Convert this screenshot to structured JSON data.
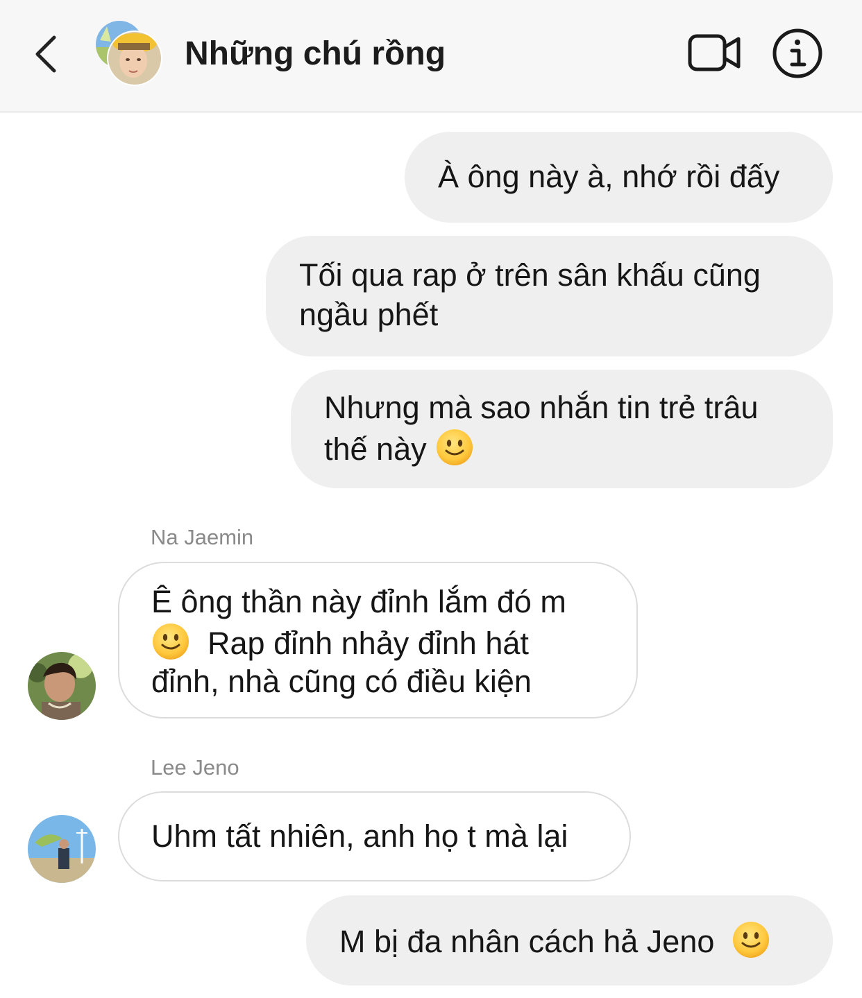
{
  "header": {
    "title": "Những chú rồng",
    "back_icon": "chevron-left-icon",
    "video_icon": "video-camera-icon",
    "info_icon": "info-icon"
  },
  "messages": [
    {
      "from": "me",
      "lines": [
        "À ông này à, nhớ rồi đấy"
      ]
    },
    {
      "from": "me",
      "lines": [
        "Tối qua rap ở trên sân khấu cũng",
        "ngầu phết"
      ]
    },
    {
      "from": "me",
      "lines": [
        "Nhưng mà sao nhắn tin trẻ trâu",
        "thế này"
      ],
      "emoji": "slightly-smiling-face"
    },
    {
      "from": "Na Jaemin",
      "lines": [
        "Ê ông thần này đỉnh lắm đó m",
        "Rap đỉnh nhảy đỉnh hát",
        "đỉnh, nhà cũng có điều kiện"
      ],
      "emoji": "slightly-smiling-face"
    },
    {
      "from": "Lee Jeno",
      "lines": [
        "Uhm tất nhiên, anh họ t mà lại"
      ]
    },
    {
      "from": "me",
      "lines": [
        "M bị đa nhân cách hả Jeno"
      ],
      "emoji": "slightly-smiling-face"
    }
  ],
  "senders": {
    "jaemin": "Na Jaemin",
    "jeno": "Lee Jeno"
  },
  "colors": {
    "header_bg": "#f7f7f7",
    "outgoing_bubble": "#efefef",
    "incoming_border": "#dcdcdc",
    "sender_name": "#8a8a8a",
    "emoji_yellow": "#ffc83d"
  }
}
